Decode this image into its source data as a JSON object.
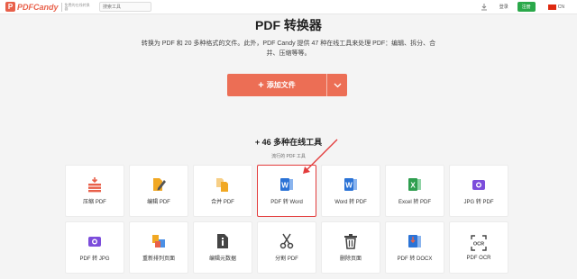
{
  "header": {
    "logo_mark": "P",
    "logo_text": "PDFCandy",
    "logo_tagline": "免费的在线转换器",
    "search_placeholder": "搜索工具",
    "login_label": "登录",
    "signup_label": "注册",
    "language": "CN"
  },
  "hero": {
    "title": "PDF 转换器",
    "description": "转换为 PDF 和 20 多种格式的文件。此外，PDF Candy 提供 47 种在线工具来处理 PDF：编辑、拆分、合并、压缩等等。",
    "add_file_label": "添加文件",
    "plus_glyph": "+"
  },
  "tools": {
    "heading": "+ 46 多种在线工具",
    "subheading": "流行的 PDF 工具",
    "items": [
      {
        "label": "压缩 PDF",
        "icon": "compress-icon",
        "color": "#e8604a"
      },
      {
        "label": "编辑 PDF",
        "icon": "edit-icon",
        "color": "#f1a823"
      },
      {
        "label": "合并 PDF",
        "icon": "merge-icon",
        "color": "#f1a823"
      },
      {
        "label": "PDF 转 Word",
        "icon": "word-icon",
        "color": "#2b73d6",
        "highlighted": true
      },
      {
        "label": "Word 转 PDF",
        "icon": "word-icon",
        "color": "#2b73d6"
      },
      {
        "label": "Excel 转 PDF",
        "icon": "excel-icon",
        "color": "#2e9e4f"
      },
      {
        "label": "JPG 转 PDF",
        "icon": "image-icon",
        "color": "#7c4ddb"
      },
      {
        "label": "PDF 转 JPG",
        "icon": "image-icon",
        "color": "#7c4ddb"
      },
      {
        "label": "重新排列页面",
        "icon": "rearrange-icon",
        "color": "#f1a823"
      },
      {
        "label": "编辑元数据",
        "icon": "info-icon",
        "color": "#444444"
      },
      {
        "label": "分割 PDF",
        "icon": "scissors-icon",
        "color": "#444444"
      },
      {
        "label": "删除页面",
        "icon": "trash-icon",
        "color": "#444444"
      },
      {
        "label": "PDF 转 DOCX",
        "icon": "docx-icon",
        "color": "#2b73d6"
      },
      {
        "label": "PDF OCR",
        "icon": "ocr-icon",
        "color": "#444444"
      }
    ]
  },
  "colors": {
    "accent": "#ec6e55",
    "signup": "#2aa84a",
    "highlight": "#e33b3b"
  }
}
